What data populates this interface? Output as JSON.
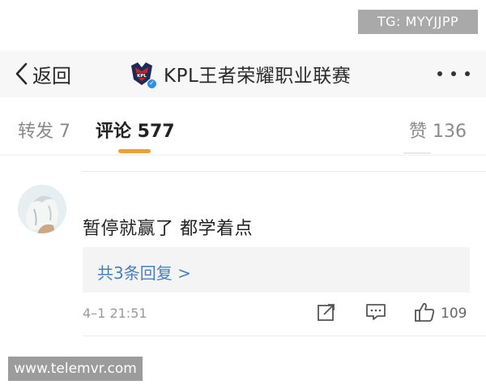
{
  "watermarks": {
    "top": "TG: MYYJJPP",
    "bottom": "www.telemvr.com"
  },
  "navbar": {
    "back_label": "返回",
    "title": "KPL王者荣耀职业联赛",
    "logo_icon": "kpl-logo",
    "verified_icon": "verified-badge-icon",
    "more_icon": "more-dots-icon"
  },
  "tabs": {
    "repost": "转发 7",
    "comment": "评论 577",
    "like": "赞 136",
    "active_color": "#f0a030"
  },
  "comment": {
    "avatar_icon": "user-avatar",
    "text": "暂停就赢了 都学着点",
    "reply_link": "共3条回复 >",
    "time": "4–1 21:51",
    "like_count": "109",
    "link_color": "#4a7ec0"
  }
}
